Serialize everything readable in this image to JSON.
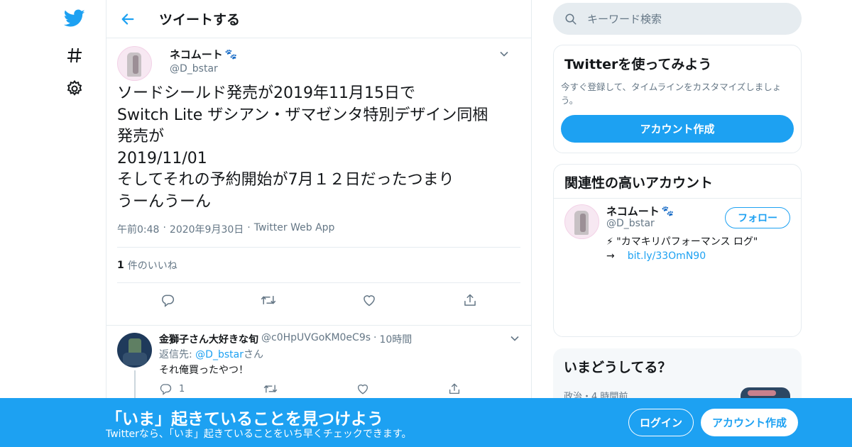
{
  "header": {
    "title": "ツイートする"
  },
  "tweet": {
    "author_name": "ネコムート",
    "author_emoji": "🐾",
    "author_handle": "@D_bstar",
    "text": "ソードシールド発売が2019年11月15日で\nSwitch Lite ザシアン・ザマゼンタ特別デザイン同梱\n発売が\n2019/11/01\nそしてそれの予約開始が7月１２日だったつまり\nうーんうーん",
    "time": "午前0:48",
    "date": "2020年9月30日",
    "source": "Twitter Web App",
    "like_count": "1",
    "like_label": "件のいいね"
  },
  "reply": {
    "name": "金獅子さん大好きな旬",
    "handle": "@c0HpUVGoKM0eC9s",
    "time": "10時間",
    "reply_to_prefix": "返信先: ",
    "reply_to_handle": "@D_bstar",
    "reply_to_suffix": "さん",
    "text": "それ俺買ったやつ！",
    "reply_count": "1"
  },
  "search": {
    "placeholder": "キーワード検索"
  },
  "signup_card": {
    "title": "Twitterを使ってみよう",
    "text": "今すぐ登録して、タイムラインをカスタマイズしましょう。",
    "button": "アカウント作成"
  },
  "related": {
    "title": "関連性の高いアカウント",
    "name": "ネコムート",
    "emoji": "🐾",
    "handle": "@D_bstar",
    "follow": "フォロー",
    "bio_line1": "⚡ \"カマキリパフォーマンス ログ\"",
    "bio_arrow": "→",
    "bio_link": "bit.ly/33OmN90"
  },
  "trends": {
    "title": "いまどうしてる？",
    "meta": "政治・4 時間前"
  },
  "bottom_bar": {
    "headline": "「いま」起きていることを見つけよう",
    "subtext": "Twitterなら、「いま」起きていることをいち早くチェックできます。",
    "login": "ログイン",
    "signup": "アカウント作成"
  },
  "colors": {
    "brand": "#1da1f2",
    "text": "#14171a",
    "muted": "#657786",
    "border": "#e6ecf0"
  }
}
